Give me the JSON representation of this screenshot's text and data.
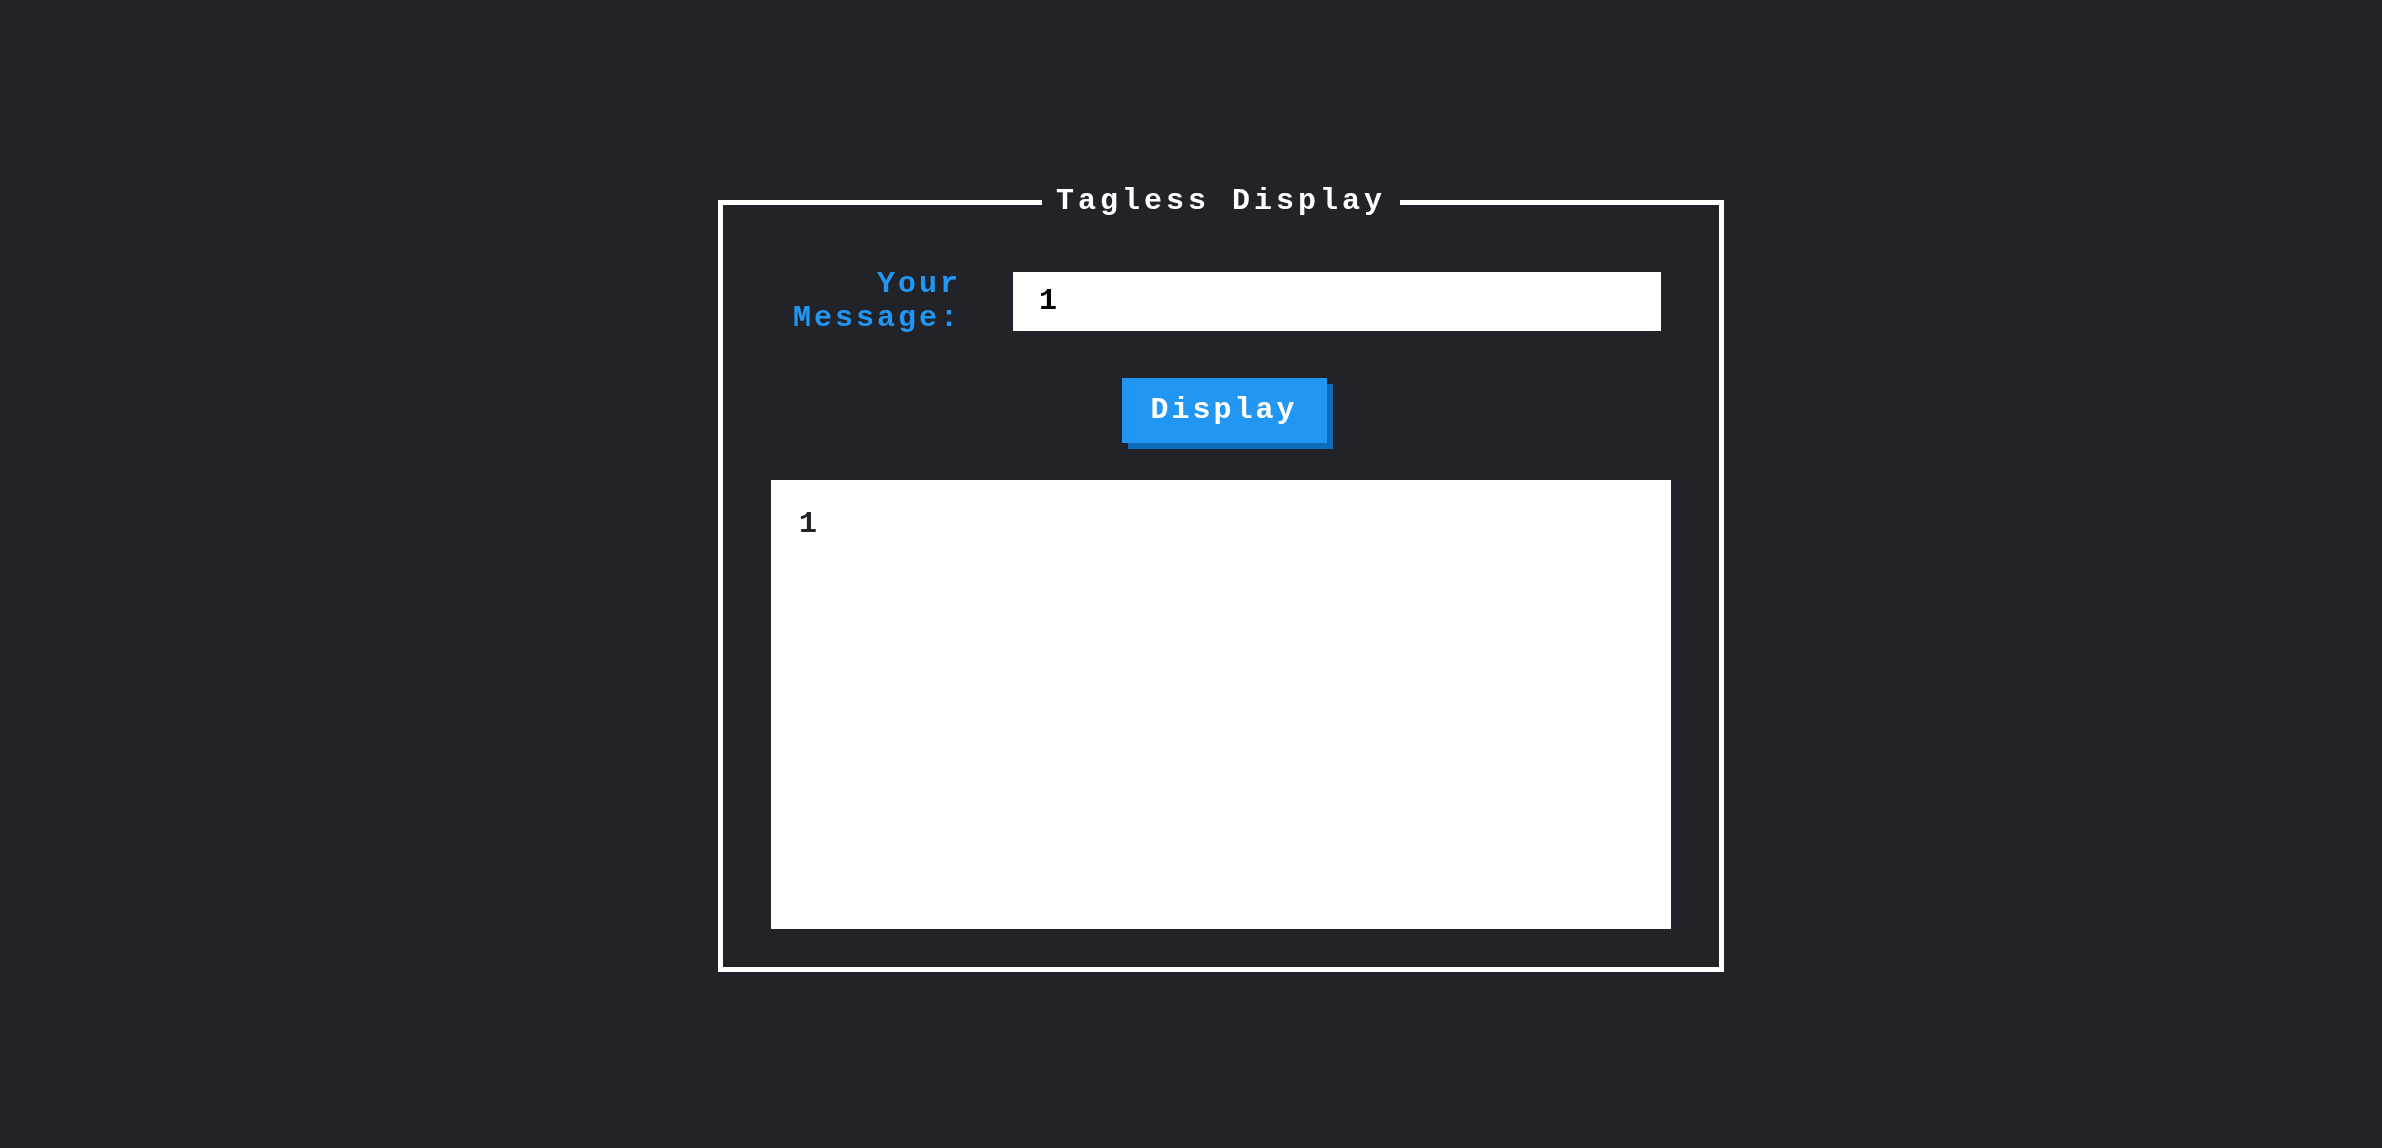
{
  "panel": {
    "title": "Tagless Display"
  },
  "message_field": {
    "label": "Your Message:",
    "value": "1"
  },
  "display_button": {
    "label": "Display"
  },
  "output": {
    "text": "1"
  }
}
